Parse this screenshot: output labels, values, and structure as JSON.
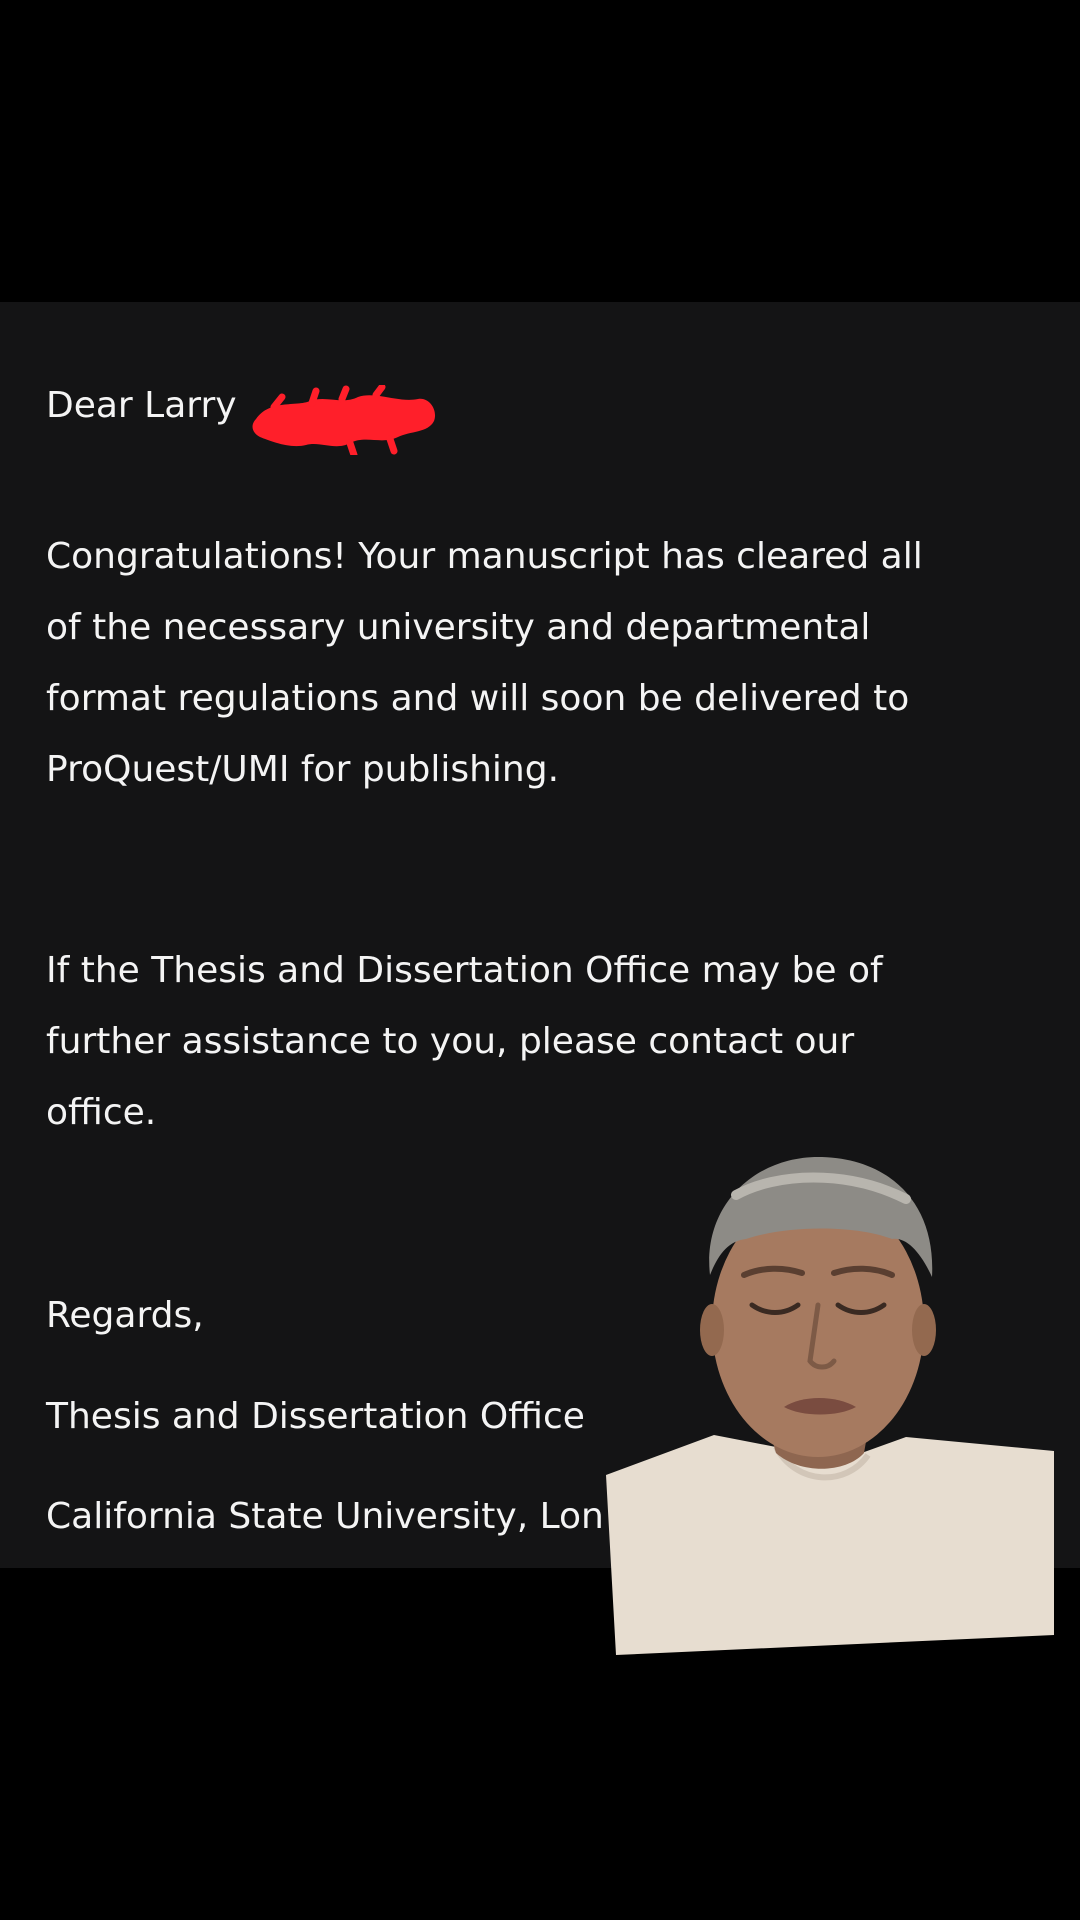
{
  "letter": {
    "greeting": "Dear Larry",
    "paragraph1": [
      "Congratulations! Your manuscript has cleared all",
      "of the necessary university and departmental",
      "format regulations and will soon be delivered to",
      "ProQuest/UMI for publishing."
    ],
    "paragraph2": [
      "If the Thesis and Dissertation Office may be of",
      "further assistance to you, please contact our",
      "office."
    ],
    "closing": "Regards,",
    "signature_office": "Thesis and Dissertation Office",
    "signature_university": "California State University, Lon"
  },
  "colors": {
    "background": "#000000",
    "panel": "#141415",
    "text": "#f4f4f4",
    "redaction": "#ff1f2a"
  }
}
